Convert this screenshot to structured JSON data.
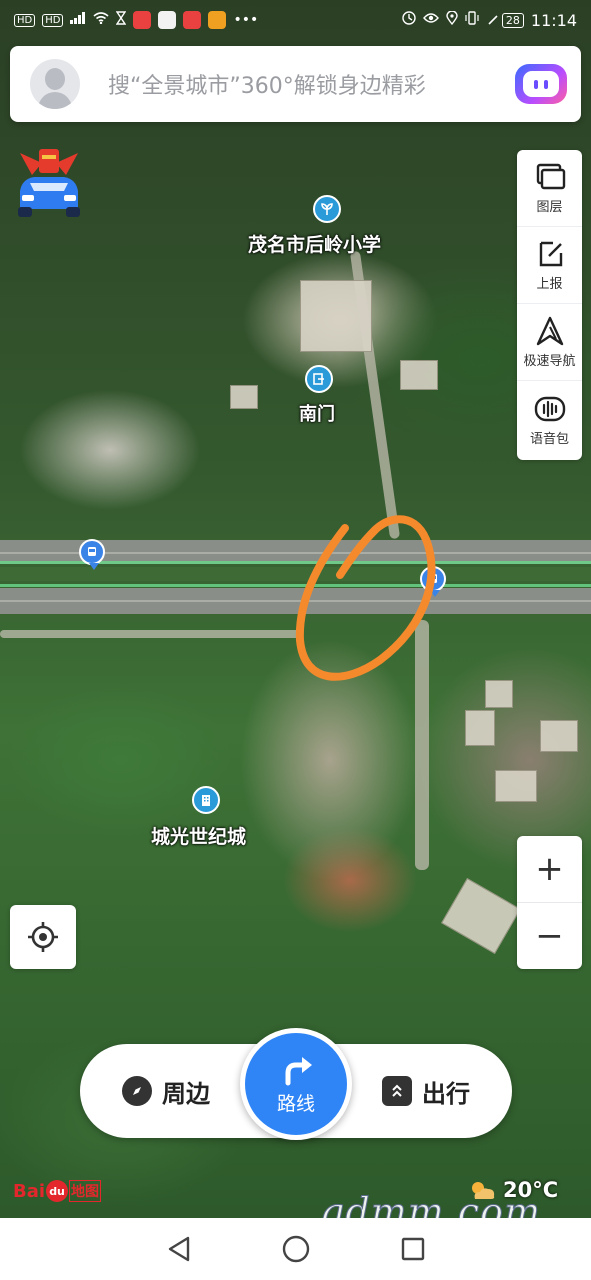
{
  "status_bar": {
    "left_tags": [
      "HD",
      "HD"
    ],
    "time": "11:14",
    "battery": "28"
  },
  "search": {
    "placeholder": "搜“全景城市”360°解锁身边精彩",
    "avatar_icon": "user-avatar-icon",
    "voice_icon": "voice-assistant-icon"
  },
  "right_panel": {
    "items": [
      {
        "label": "图层",
        "icon": "layers-icon"
      },
      {
        "label": "上报",
        "icon": "report-icon"
      },
      {
        "label": "极速导航",
        "icon": "navigation-arrow-icon"
      },
      {
        "label": "语音包",
        "icon": "voice-pack-icon"
      }
    ]
  },
  "map": {
    "pois": [
      {
        "label": "茂名市后岭小学",
        "icon": "school-icon"
      },
      {
        "label": "南门",
        "icon": "gate-icon"
      },
      {
        "label": "城光世纪城",
        "icon": "building-icon"
      }
    ],
    "annotation_color": "#f58a2d"
  },
  "zoom": {
    "in": "+",
    "out": "−"
  },
  "bottom_nav": {
    "nearby": "周边",
    "route": "路线",
    "travel": "出行"
  },
  "branding": {
    "logo_bai": "Bai",
    "logo_du": "du",
    "logo_map": "地图",
    "temperature": "20°C",
    "watermark": "gdmm.com"
  },
  "colors": {
    "accent": "#3085f6",
    "bus_stop": "#3a84e8",
    "poi": "#2a9ad8"
  }
}
